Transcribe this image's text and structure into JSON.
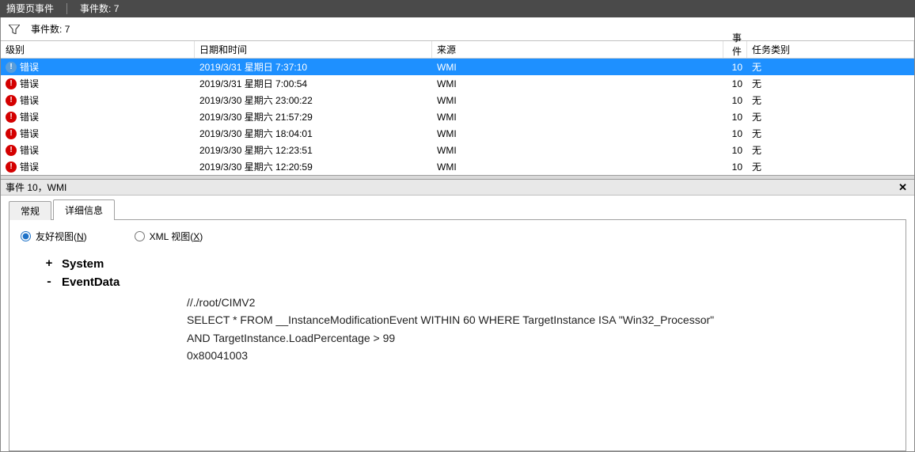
{
  "titlebar": {
    "title": "摘要页事件",
    "count_label": "事件数:",
    "count_value": "7"
  },
  "filterbar": {
    "count_label": "事件数:",
    "count_value": "7"
  },
  "columns": {
    "level": "级别",
    "date": "日期和时间",
    "source": "来源",
    "id": "事件 ID",
    "task": "任务类别"
  },
  "rows": [
    {
      "level": "错误",
      "date": "2019/3/31 星期日 7:37:10",
      "source": "WMI",
      "id": "10",
      "task": "无",
      "selected": true
    },
    {
      "level": "错误",
      "date": "2019/3/31 星期日 7:00:54",
      "source": "WMI",
      "id": "10",
      "task": "无",
      "selected": false
    },
    {
      "level": "错误",
      "date": "2019/3/30 星期六 23:00:22",
      "source": "WMI",
      "id": "10",
      "task": "无",
      "selected": false
    },
    {
      "level": "错误",
      "date": "2019/3/30 星期六 21:57:29",
      "source": "WMI",
      "id": "10",
      "task": "无",
      "selected": false
    },
    {
      "level": "错误",
      "date": "2019/3/30 星期六 18:04:01",
      "source": "WMI",
      "id": "10",
      "task": "无",
      "selected": false
    },
    {
      "level": "错误",
      "date": "2019/3/30 星期六 12:23:51",
      "source": "WMI",
      "id": "10",
      "task": "无",
      "selected": false
    },
    {
      "level": "错误",
      "date": "2019/3/30 星期六 12:20:59",
      "source": "WMI",
      "id": "10",
      "task": "无",
      "selected": false
    }
  ],
  "detail": {
    "title": "事件 10，WMI",
    "tabs": {
      "general": "常规",
      "details": "详细信息"
    },
    "radios": {
      "friendly_prefix": "友好视图(",
      "friendly_key": "N",
      "friendly_suffix": ")",
      "xml_prefix": "XML 视图(",
      "xml_key": "X",
      "xml_suffix": ")"
    },
    "tree": {
      "system_toggle": "+",
      "system_label": "System",
      "eventdata_toggle": "-",
      "eventdata_label": "EventData",
      "lines": [
        "//./root/CIMV2",
        "SELECT * FROM __InstanceModificationEvent WITHIN 60 WHERE TargetInstance ISA \"Win32_Processor\" AND TargetInstance.LoadPercentage > 99",
        "0x80041003"
      ]
    }
  }
}
